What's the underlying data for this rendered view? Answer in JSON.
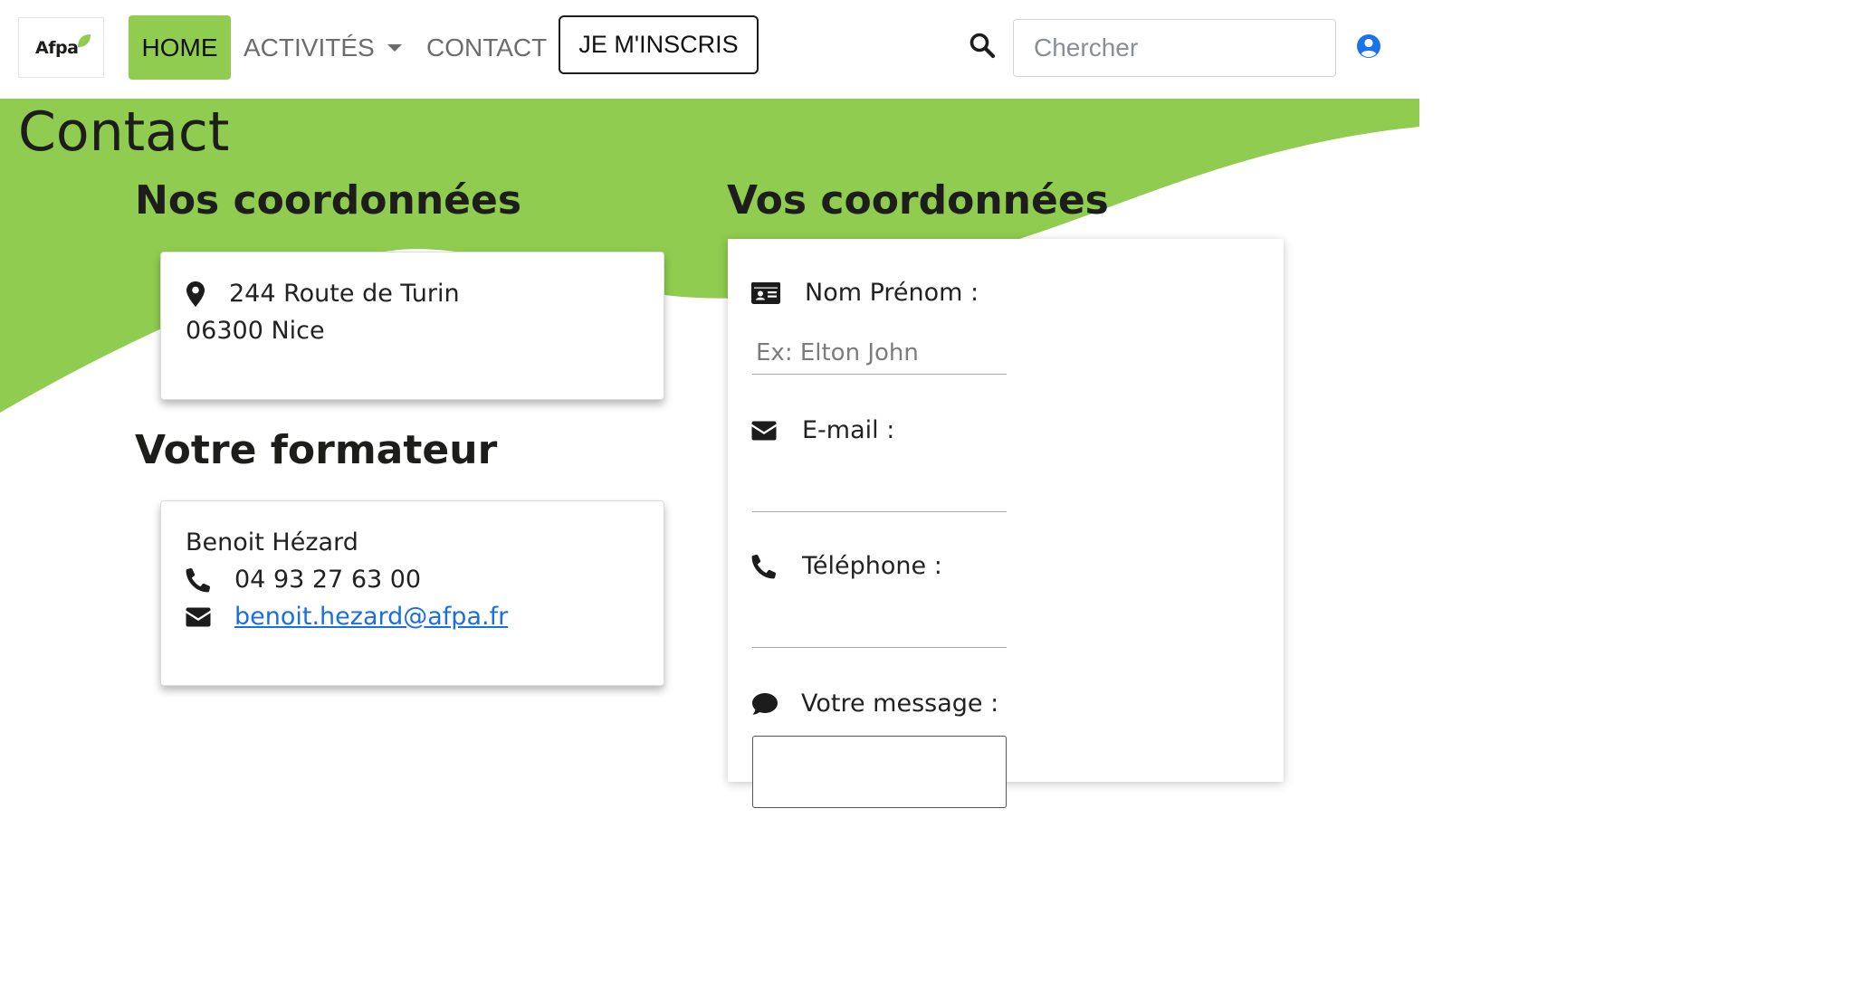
{
  "nav": {
    "logo_text": "Afpa",
    "home": "HOME",
    "activites": "ACTIVITÉS",
    "contact": "CONTACT",
    "inscris": "JE M'INSCRIS",
    "search_placeholder": "Chercher"
  },
  "page": {
    "title": "Contact"
  },
  "nos_coordonnees": {
    "title": "Nos coordonnées",
    "address_line1": "244 Route de Turin",
    "address_line2": "06300 Nice"
  },
  "formateur": {
    "title": "Votre formateur",
    "name": "Benoit Hézard",
    "phone": "04 93 27 63 00",
    "email": "benoit.hezard@afpa.fr"
  },
  "form": {
    "title": "Vos coordonnées",
    "name_label": "Nom Prénom :",
    "name_placeholder": "Ex: Elton John",
    "email_label": "E-mail :",
    "phone_label": "Téléphone :",
    "message_label": "Votre message :"
  },
  "colors": {
    "brand_green": "#8fcc4f",
    "link_blue": "#1a6fe0",
    "user_icon_blue": "#1a73e8"
  },
  "icons": {
    "search": "search-icon",
    "user": "user-circle-icon",
    "address": "map-marker-icon",
    "phone": "phone-icon",
    "email": "envelope-icon",
    "name": "id-card-icon",
    "message": "comment-icon"
  }
}
